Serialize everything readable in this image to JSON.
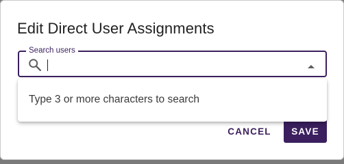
{
  "colors": {
    "accent": "#3b1f5e",
    "title_text": "#212121",
    "dropdown_text": "#3a3a3a"
  },
  "dialog": {
    "title": "Edit Direct User Assignments"
  },
  "search": {
    "label": "Search users",
    "value": "",
    "icon": "search-icon",
    "toggle_icon": "arrow-up-icon"
  },
  "dropdown": {
    "message": "Type 3 or more characters to search"
  },
  "actions": {
    "cancel_label": "CANCEL",
    "save_label": "SAVE"
  }
}
